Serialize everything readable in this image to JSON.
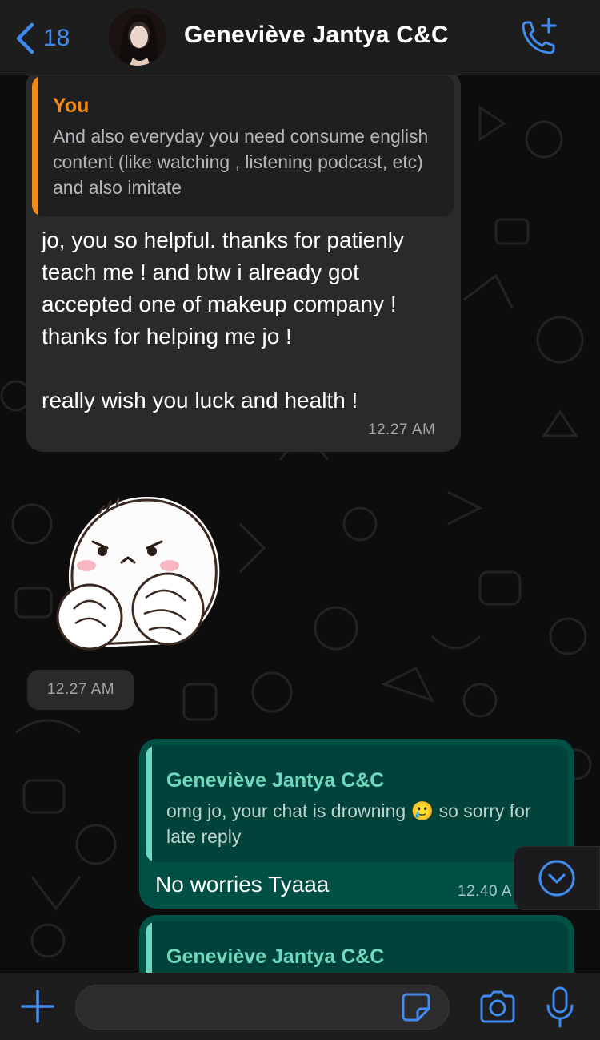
{
  "header": {
    "back_count": "18",
    "contact_name": "Geneviève Jantya C&C",
    "accent_color": "#3f8bf0"
  },
  "messages": [
    {
      "direction": "incoming",
      "quote": {
        "author": "You",
        "author_color": "#f28a17",
        "text": "And also everyday you need consume english content (like watching , listening podcast, etc) and also imitate"
      },
      "text": "jo, you so helpful. thanks for patienly teach me ! and btw i already got accepted one of makeup company ! thanks for helping me jo !\n\nreally wish you luck and health !",
      "time": "12.27 AM"
    },
    {
      "direction": "incoming",
      "type": "sticker",
      "sticker_icon": "angry-bun-sticker",
      "time": "12.27 AM"
    },
    {
      "direction": "outgoing",
      "quote": {
        "author": "Geneviève Jantya C&C",
        "author_color": "#6fd9c0",
        "text_before_emoji": "omg jo, your chat is drowning",
        "emoji": "🥲",
        "text_after_emoji": "so sorry for late reply"
      },
      "text": "No worries Tyaaa",
      "time": "12.40 A"
    },
    {
      "direction": "outgoing",
      "quote": {
        "author": "Geneviève Jantya C&C",
        "author_color": "#6fd9c0"
      }
    }
  ],
  "input": {
    "placeholder": ""
  },
  "icons": {
    "back": "chevron-left-icon",
    "call": "phone-add-icon",
    "scroll": "chevron-down-circle-icon",
    "attach": "plus-icon",
    "sticker": "sticker-icon",
    "camera": "camera-icon",
    "mic": "microphone-icon"
  }
}
